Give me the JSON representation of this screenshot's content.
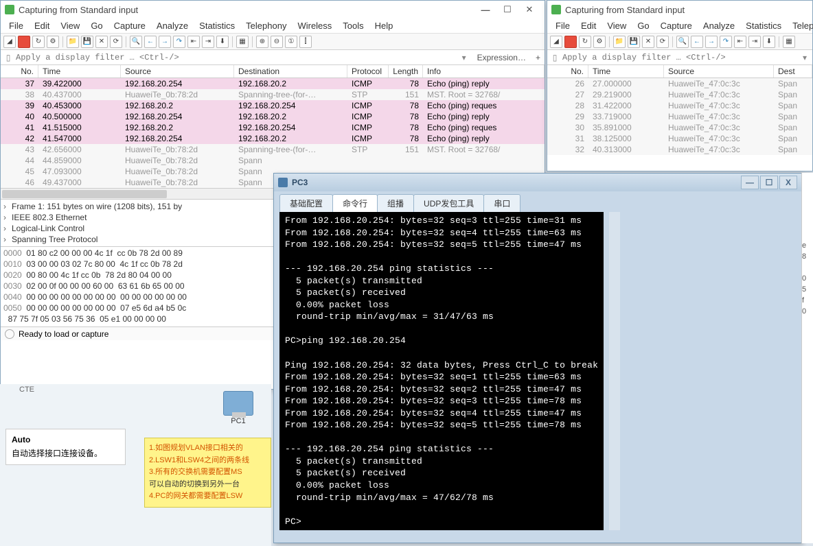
{
  "wireshark1": {
    "title": "Capturing from Standard input",
    "menus": [
      "File",
      "Edit",
      "View",
      "Go",
      "Capture",
      "Analyze",
      "Statistics",
      "Telephony",
      "Wireless",
      "Tools",
      "Help"
    ],
    "filter_placeholder": "Apply a display filter … <Ctrl-/>",
    "expression_label": "Expression",
    "columns": [
      "No.",
      "Time",
      "Source",
      "Destination",
      "Protocol",
      "Length",
      "Info"
    ],
    "rows": [
      {
        "no": "37",
        "time": "39.422000",
        "src": "192.168.20.254",
        "dst": "192.168.20.2",
        "proto": "ICMP",
        "len": "78",
        "info": "Echo (ping) reply",
        "cls": "pink"
      },
      {
        "no": "38",
        "time": "40.437000",
        "src": "HuaweiTe_0b:78:2d",
        "dst": "Spanning-tree-(for-…",
        "proto": "STP",
        "len": "151",
        "info": "MST. Root = 32768/",
        "cls": "grey"
      },
      {
        "no": "39",
        "time": "40.453000",
        "src": "192.168.20.2",
        "dst": "192.168.20.254",
        "proto": "ICMP",
        "len": "78",
        "info": "Echo (ping) reques",
        "cls": "pink"
      },
      {
        "no": "40",
        "time": "40.500000",
        "src": "192.168.20.254",
        "dst": "192.168.20.2",
        "proto": "ICMP",
        "len": "78",
        "info": "Echo (ping) reply",
        "cls": "pink"
      },
      {
        "no": "41",
        "time": "41.515000",
        "src": "192.168.20.2",
        "dst": "192.168.20.254",
        "proto": "ICMP",
        "len": "78",
        "info": "Echo (ping) reques",
        "cls": "pink"
      },
      {
        "no": "42",
        "time": "41.547000",
        "src": "192.168.20.254",
        "dst": "192.168.20.2",
        "proto": "ICMP",
        "len": "78",
        "info": "Echo (ping) reply",
        "cls": "pink"
      },
      {
        "no": "43",
        "time": "42.656000",
        "src": "HuaweiTe_0b:78:2d",
        "dst": "Spanning-tree-(for-…",
        "proto": "STP",
        "len": "151",
        "info": "MST. Root = 32768/",
        "cls": "grey"
      },
      {
        "no": "44",
        "time": "44.859000",
        "src": "HuaweiTe_0b:78:2d",
        "dst": "Spann",
        "proto": "",
        "len": "",
        "info": "",
        "cls": "grey"
      },
      {
        "no": "45",
        "time": "47.093000",
        "src": "HuaweiTe_0b:78:2d",
        "dst": "Spann",
        "proto": "",
        "len": "",
        "info": "",
        "cls": "grey"
      },
      {
        "no": "46",
        "time": "49.437000",
        "src": "HuaweiTe_0b:78:2d",
        "dst": "Spann",
        "proto": "",
        "len": "",
        "info": "",
        "cls": "grey"
      }
    ],
    "tree": [
      "Frame 1: 151 bytes on wire (1208 bits), 151 by",
      "IEEE 802.3 Ethernet",
      "Logical-Link Control",
      "Spanning Tree Protocol"
    ],
    "hex": [
      {
        "off": "0000",
        "b": "01 80 c2 00 00 00 4c 1f  cc 0b 78 2d 00 89"
      },
      {
        "off": "0010",
        "b": "03 00 00 03 02 7c 80 00  4c 1f cc 0b 78 2d"
      },
      {
        "off": "0020",
        "b": "00 80 00 4c 1f cc 0b  78 2d 80 04 00 00"
      },
      {
        "off": "0030",
        "b": "02 00 0f 00 00 00 60 00  63 61 6b 65 00 00"
      },
      {
        "off": "0040",
        "b": "00 00 00 00 00 00 00 00  00 00 00 00 00 00"
      },
      {
        "off": "0050",
        "b": "00 00 00 00 00 00 00 00  07 e5 6d a4 b5 0c"
      },
      {
        "off": "",
        "b": "87 75 7f 05 03 56 75 36  05 e1 00 00 00 00"
      }
    ],
    "status": "Ready to load or capture"
  },
  "wireshark2": {
    "title": "Capturing from Standard input",
    "menus": [
      "File",
      "Edit",
      "View",
      "Go",
      "Capture",
      "Analyze",
      "Statistics",
      "Telephony"
    ],
    "filter_placeholder": "Apply a display filter … <Ctrl-/>",
    "columns": [
      "No.",
      "Time",
      "Source",
      "Dest"
    ],
    "rows": [
      {
        "no": "26",
        "time": "27.000000",
        "src": "HuaweiTe_47:0c:3c",
        "dst": "Span"
      },
      {
        "no": "27",
        "time": "29.219000",
        "src": "HuaweiTe_47:0c:3c",
        "dst": "Span"
      },
      {
        "no": "28",
        "time": "31.422000",
        "src": "HuaweiTe_47:0c:3c",
        "dst": "Span"
      },
      {
        "no": "29",
        "time": "33.719000",
        "src": "HuaweiTe_47:0c:3c",
        "dst": "Span"
      },
      {
        "no": "30",
        "time": "35.891000",
        "src": "HuaweiTe_47:0c:3c",
        "dst": "Span"
      },
      {
        "no": "31",
        "time": "38.125000",
        "src": "HuaweiTe_47:0c:3c",
        "dst": "Span"
      },
      {
        "no": "32",
        "time": "40.313000",
        "src": "HuaweiTe_47:0c:3c",
        "dst": "Span"
      }
    ]
  },
  "topo": {
    "pc1_label": "PC1",
    "cte_label": "CTE"
  },
  "sidebar": {
    "title": "Auto",
    "text": "自动选择接口连接设备。"
  },
  "note": {
    "l1": "1.如图规划VLAN接口相关的",
    "l2": "2.LSW1和LSW4之间的两条线",
    "l3": "3.所有的交换机需要配置MS",
    "l4": "可以自动的切换到另外一台",
    "l5": "4.PC的网关都需要配置LSW"
  },
  "pc3": {
    "title": "PC3",
    "tabs": [
      "基础配置",
      "命令行",
      "组播",
      "UDP发包工具",
      "串口"
    ],
    "active_tab": 1,
    "terminal": "From 192.168.20.254: bytes=32 seq=3 ttl=255 time=31 ms\nFrom 192.168.20.254: bytes=32 seq=4 ttl=255 time=63 ms\nFrom 192.168.20.254: bytes=32 seq=5 ttl=255 time=47 ms\n\n--- 192.168.20.254 ping statistics ---\n  5 packet(s) transmitted\n  5 packet(s) received\n  0.00% packet loss\n  round-trip min/avg/max = 31/47/63 ms\n\nPC>ping 192.168.20.254\n\nPing 192.168.20.254: 32 data bytes, Press Ctrl_C to break\nFrom 192.168.20.254: bytes=32 seq=1 ttl=255 time=63 ms\nFrom 192.168.20.254: bytes=32 seq=2 ttl=255 time=47 ms\nFrom 192.168.20.254: bytes=32 seq=3 ttl=255 time=78 ms\nFrom 192.168.20.254: bytes=32 seq=4 ttl=255 time=47 ms\nFrom 192.168.20.254: bytes=32 seq=5 ttl=255 time=78 ms\n\n--- 192.168.20.254 ping statistics ---\n  5 packet(s) transmitted\n  5 packet(s) received\n  0.00% packet loss\n  round-trip min/avg/max = 47/62/78 ms\n\nPC>"
  },
  "rightfrag": [
    "e",
    "8",
    "",
    "0",
    "5",
    "f",
    "0"
  ]
}
